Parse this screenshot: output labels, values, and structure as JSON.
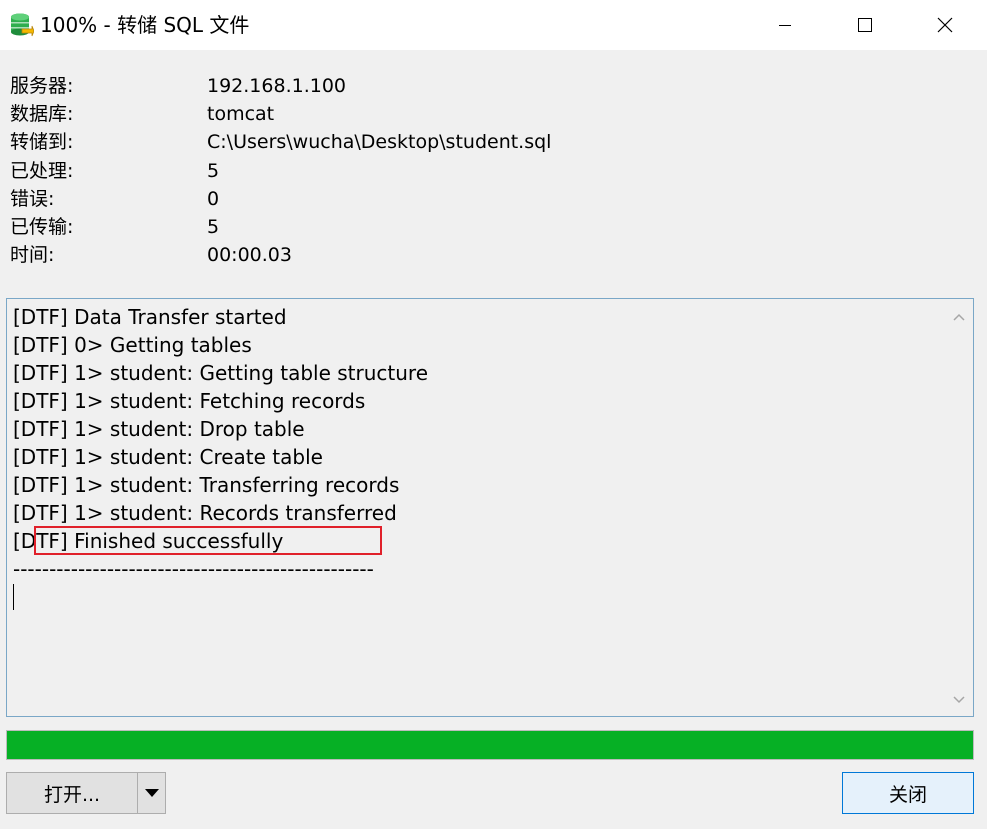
{
  "window": {
    "title": "100% - 转储 SQL 文件",
    "icon": "database-export-icon"
  },
  "info": {
    "rows": [
      {
        "label": "服务器:",
        "value": "192.168.1.100"
      },
      {
        "label": "数据库:",
        "value": "tomcat"
      },
      {
        "label": "转储到:",
        "value": "C:\\Users\\wucha\\Desktop\\student.sql"
      },
      {
        "label": "已处理:",
        "value": "5"
      },
      {
        "label": "错误:",
        "value": "0"
      },
      {
        "label": "已传输:",
        "value": "5"
      },
      {
        "label": "时间:",
        "value": "00:00.03"
      }
    ]
  },
  "log": {
    "lines": [
      "[DTF] Data Transfer started",
      "[DTF] 0> Getting tables",
      "[DTF] 1> student: Getting table structure",
      "[DTF] 1> student: Fetching records",
      "[DTF] 1> student: Drop table",
      "[DTF] 1> student: Create table",
      "[DTF] 1> student: Transferring records",
      "[DTF] 1> student: Records transferred",
      "[DTF] Finished successfully",
      "--------------------------------------------------"
    ],
    "highlight_color": "#e0202a"
  },
  "progress": {
    "percent": 100,
    "color": "#06b025"
  },
  "buttons": {
    "open_label": "打开...",
    "close_label": "关闭"
  }
}
